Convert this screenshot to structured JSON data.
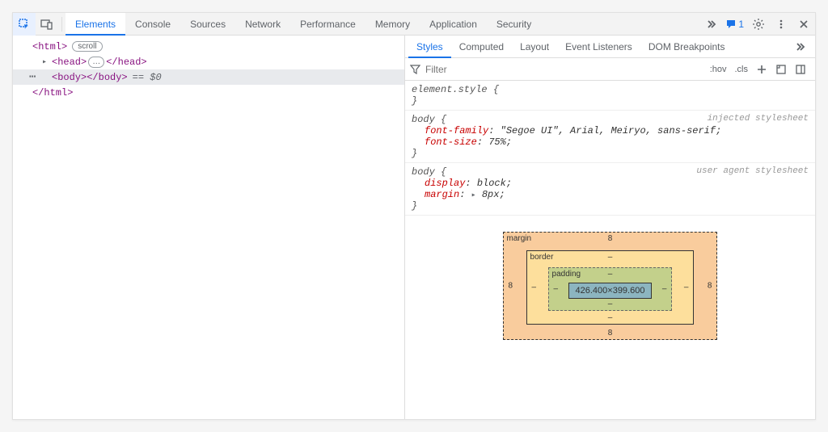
{
  "top_tabs": {
    "elements": "Elements",
    "console": "Console",
    "sources": "Sources",
    "network": "Network",
    "performance": "Performance",
    "memory": "Memory",
    "application": "Application",
    "security": "Security",
    "message_count": "1"
  },
  "dom": {
    "html_open": "<html>",
    "scroll_badge": "scroll",
    "head_open": "<head>",
    "head_close": "</head>",
    "ellipsis": "…",
    "body_open": "<body>",
    "body_close": "</body>",
    "selected_marker": "== $0",
    "html_close": "</html>"
  },
  "sub_tabs": {
    "styles": "Styles",
    "computed": "Computed",
    "layout": "Layout",
    "event_listeners": "Event Listeners",
    "dom_breakpoints": "DOM Breakpoints"
  },
  "filter": {
    "placeholder": "Filter",
    "hov": ":hov",
    "cls": ".cls"
  },
  "styles": {
    "element_style": "element.style {",
    "close_brace": "}",
    "body_rule1": {
      "selector": "body {",
      "source": "injected stylesheet",
      "font_family_name": "font-family",
      "font_family_value": "\"Segoe UI\", Arial, Meiryo, sans-serif",
      "font_size_name": "font-size",
      "font_size_value": "75%"
    },
    "body_rule2": {
      "selector": "body {",
      "source": "user agent stylesheet",
      "display_name": "display",
      "display_value": "block",
      "margin_name": "margin",
      "margin_value": "8px"
    }
  },
  "box_model": {
    "margin_label": "margin",
    "margin_val": "8",
    "border_label": "border",
    "border_val": "–",
    "padding_label": "padding",
    "padding_val": "–",
    "content": "426.400×399.600"
  }
}
